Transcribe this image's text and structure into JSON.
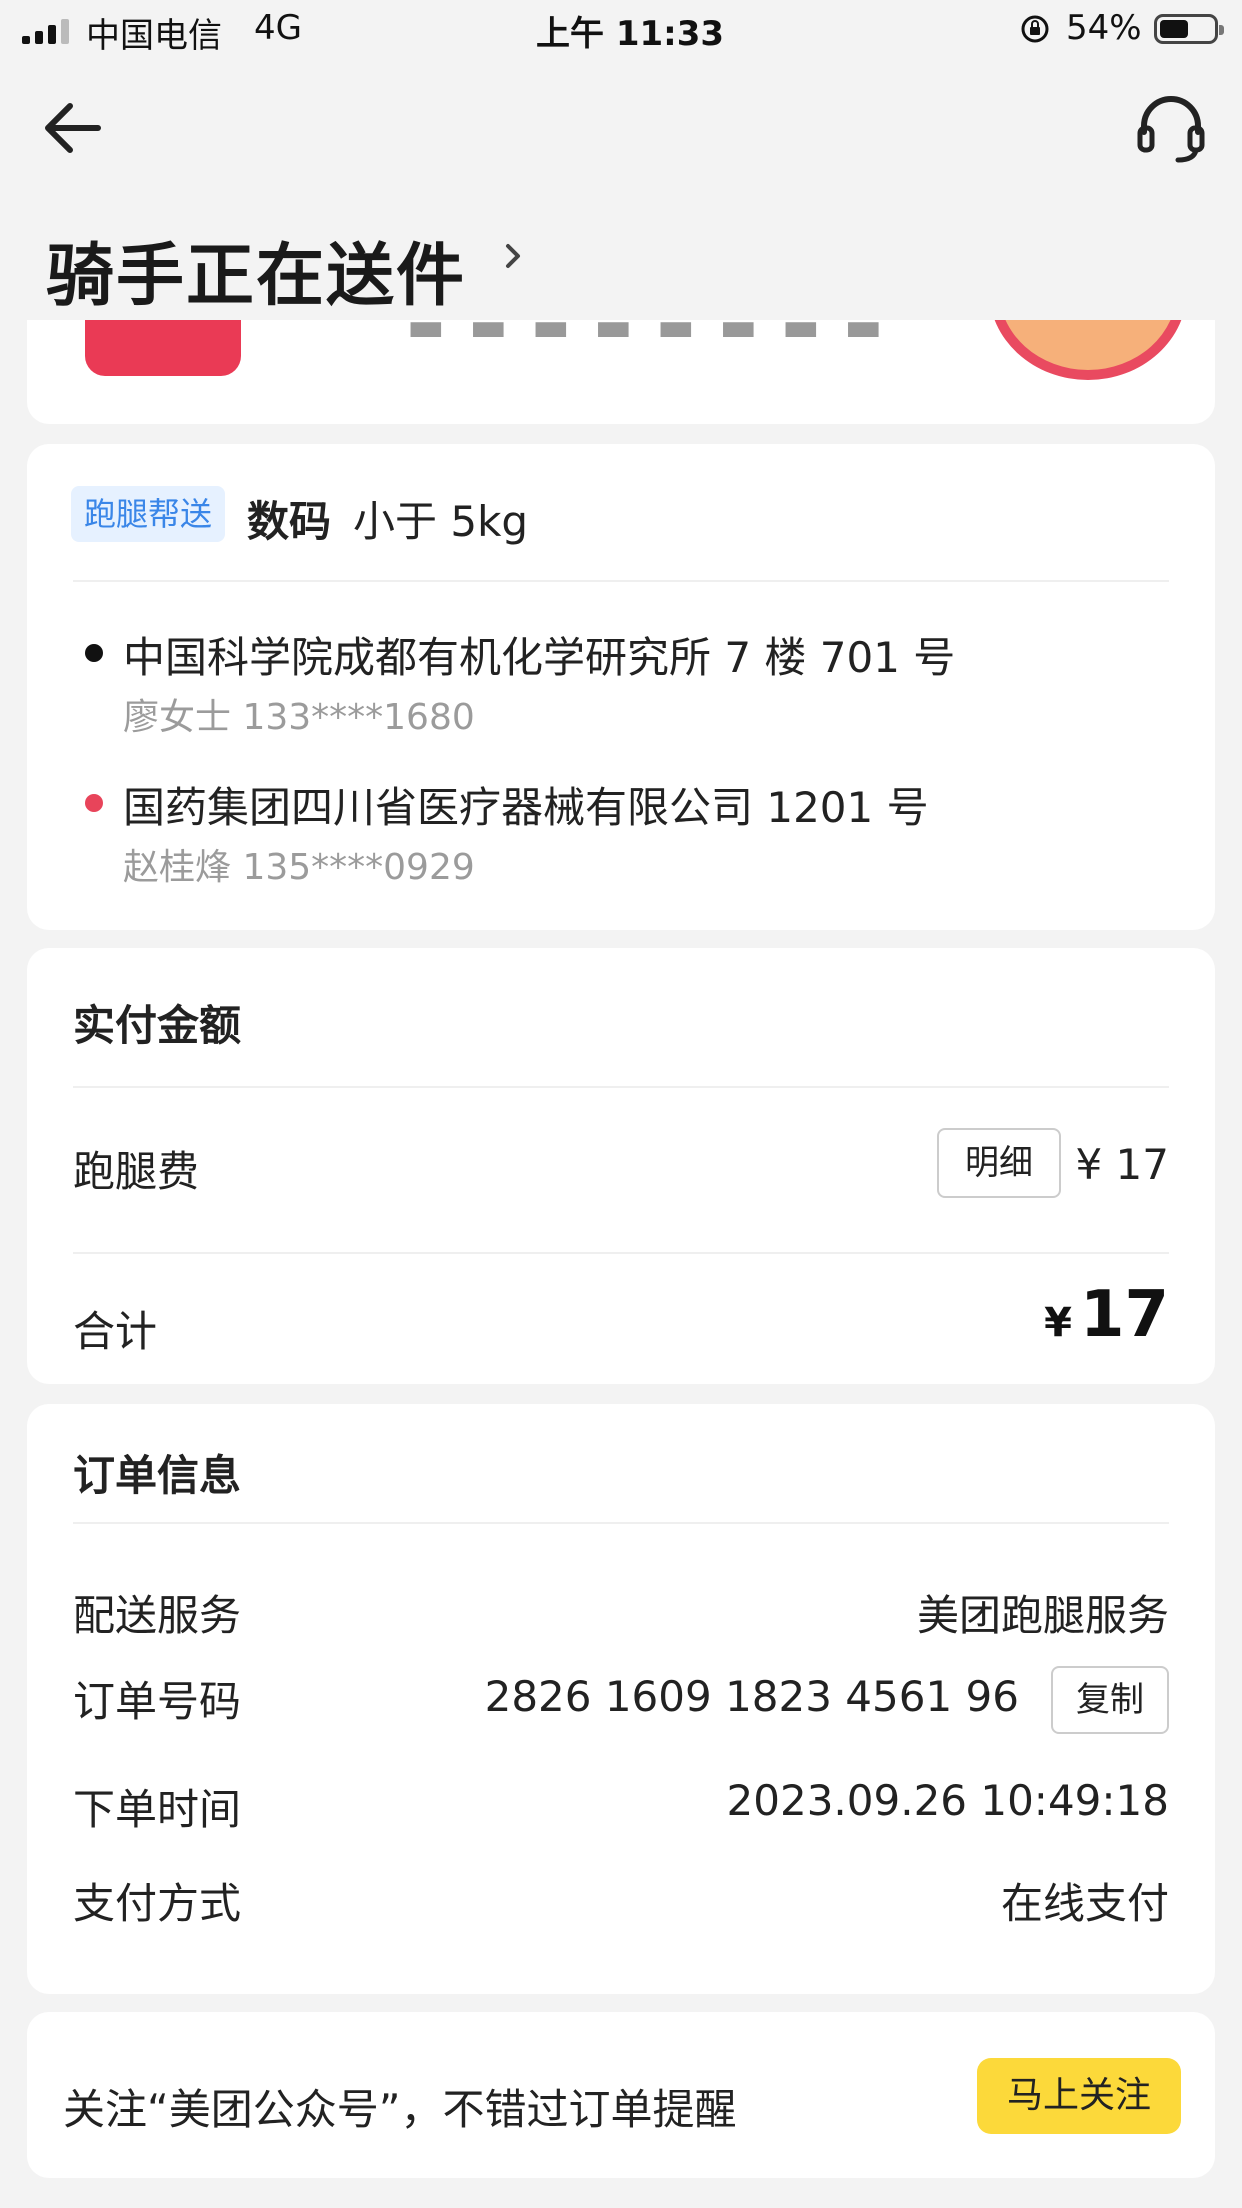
{
  "status_bar": {
    "carrier": "中国电信",
    "network": "4G",
    "time": "上午 11:33",
    "battery": "54%",
    "battery_level": 0.54
  },
  "header": {
    "back_icon": "back-arrow-icon",
    "service_icon": "headset-icon",
    "title": "骑手正在送件",
    "title_chevron": "chevron-right-icon"
  },
  "order": {
    "tag": "跑腿帮送",
    "category": "数码",
    "weight": "小于 5kg",
    "pickup": {
      "address": "中国科学院成都有机化学研究所 7 楼 701 号",
      "contact": "廖女士 133****1680",
      "dot_color": "#111111"
    },
    "dropoff": {
      "address": "国药集团四川省医疗器械有限公司 1201 号",
      "contact": "赵桂烽 135****0929",
      "dot_color": "#e8445a"
    }
  },
  "payment": {
    "title": "实付金额",
    "fee_label": "跑腿费",
    "detail_button": "明细",
    "fee_value": "¥ 17",
    "total_label": "合计",
    "total_currency": "¥",
    "total_amount": "17"
  },
  "info": {
    "title": "订单信息",
    "rows": [
      {
        "label": "配送服务",
        "value": "美团跑腿服务"
      },
      {
        "label": "订单号码",
        "value": "2826 1609 1823 4561 96"
      },
      {
        "label": "下单时间",
        "value": "2023.09.26 10:49:18"
      },
      {
        "label": "支付方式",
        "value": "在线支付"
      }
    ],
    "copy_button": "复制"
  },
  "follow": {
    "text": "关注“美团公众号”，不错过订单提醒",
    "button": "马上关注"
  },
  "colors": {
    "background": "#f3f3f3",
    "tag_bg": "#e6f1ff",
    "tag_text": "#3a86e8",
    "follow_button": "#fcd93a",
    "dropoff_dot": "#e8445a"
  }
}
